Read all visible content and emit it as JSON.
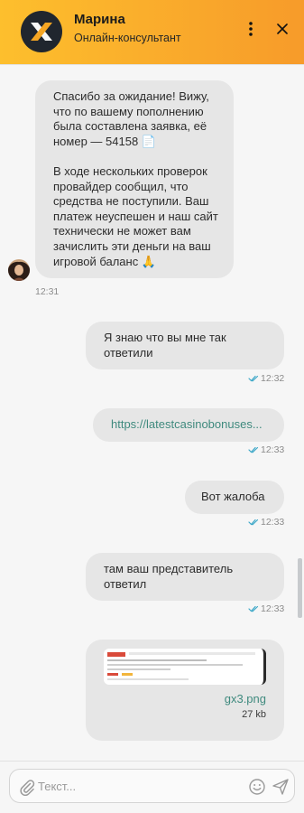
{
  "header": {
    "name": "Марина",
    "subtitle": "Онлайн-консультант",
    "logo_icon": "x-logo-icon",
    "colors": {
      "gradient_start": "#fdbf2d",
      "gradient_end": "#f79b2a"
    }
  },
  "messages": {
    "incoming": {
      "text": "Спасибо за ожидание! Вижу, что по вашему пополнению была составлена заявка, её номер — 54158 📄\n\nВ ходе нескольких проверок провайдер сообщил, что средства не поступили. Ваш платеж неуспешен и наш сайт технически не может вам зачислить эти деньги на ваш игровой баланс 🙏",
      "time": "12:31"
    },
    "outgoing": [
      {
        "text": "Я знаю что вы мне так ответили",
        "time": "12:32"
      },
      {
        "text": "https://latestcasinobonuses...",
        "time": "12:33",
        "is_link": true
      },
      {
        "text": "Вот жалоба",
        "time": "12:33"
      },
      {
        "text": "там ваш представитель ответил",
        "time": "12:33"
      }
    ],
    "file": {
      "name": "gx3.png",
      "size": "27 kb"
    }
  },
  "composer": {
    "placeholder": "Текст..."
  },
  "colors": {
    "read_check": "#3ea8c8",
    "link": "#3f8a7e",
    "bubble": "#e6e6e6"
  }
}
